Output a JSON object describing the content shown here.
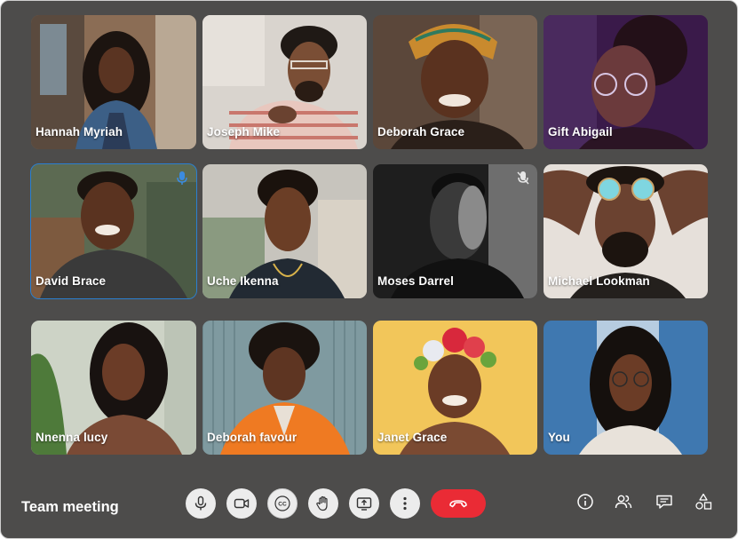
{
  "meeting": {
    "title": "Team meeting"
  },
  "participants": [
    {
      "name": "Hannah Myriah"
    },
    {
      "name": "Joseph Mike"
    },
    {
      "name": "Deborah Grace"
    },
    {
      "name": "Gift Abigail"
    },
    {
      "name": "David Brace",
      "speaking": true,
      "mic": "on"
    },
    {
      "name": "Uche Ikenna"
    },
    {
      "name": "Moses Darrel",
      "mic": "muted"
    },
    {
      "name": "Michael Lookman"
    },
    {
      "name": "Nnenna lucy"
    },
    {
      "name": "Deborah favour"
    },
    {
      "name": "Janet Grace"
    },
    {
      "name": "You"
    }
  ],
  "controls": {
    "cc_label": "CC",
    "icons": [
      "microphone-icon",
      "video-camera-icon",
      "closed-captions-icon",
      "raise-hand-icon",
      "screen-share-icon",
      "more-options-icon",
      "end-call-icon"
    ]
  },
  "side_icons": [
    "info-icon",
    "participants-icon",
    "chat-icon",
    "activities-icon"
  ],
  "colors": {
    "background": "#4d4c4b",
    "end_call": "#ea2b35",
    "active_speaker_border": "#2b7fd0",
    "control_bg": "#ececec"
  }
}
